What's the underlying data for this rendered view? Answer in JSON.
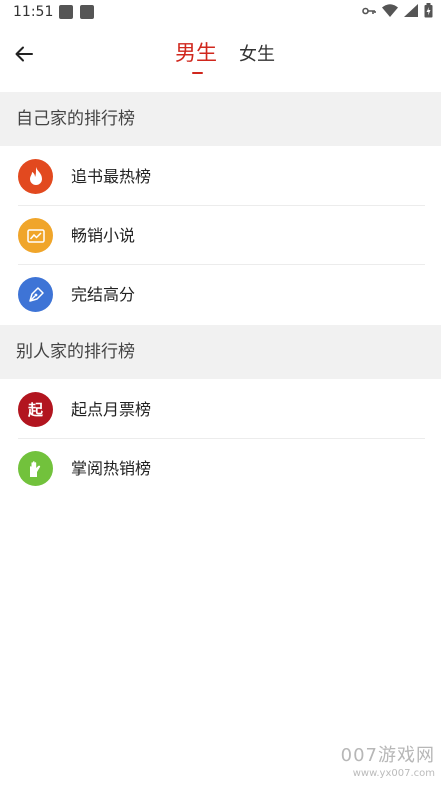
{
  "status_bar": {
    "time": "11:51"
  },
  "header": {
    "tabs": [
      {
        "label": "男生",
        "active": true
      },
      {
        "label": "女生",
        "active": false
      }
    ],
    "accent_color": "#d0271d"
  },
  "sections": [
    {
      "title": "自己家的排行榜",
      "items": [
        {
          "label": "追书最热榜",
          "icon": "flame-icon",
          "color": "#e2491f"
        },
        {
          "label": "畅销小说",
          "icon": "sales-chart-icon",
          "color": "#f0a52a"
        },
        {
          "label": "完结高分",
          "icon": "pen-nib-icon",
          "color": "#3e74d6"
        }
      ]
    },
    {
      "title": "别人家的排行榜",
      "items": [
        {
          "label": "起点月票榜",
          "icon": "qidian-logo-icon",
          "glyph": "起",
          "color": "#b2151f"
        },
        {
          "label": "掌阅热销榜",
          "icon": "zhangyue-logo-icon",
          "color": "#72c23c"
        }
      ]
    }
  ],
  "watermark": {
    "main": "007游戏网",
    "url": "www.yx007.com"
  }
}
